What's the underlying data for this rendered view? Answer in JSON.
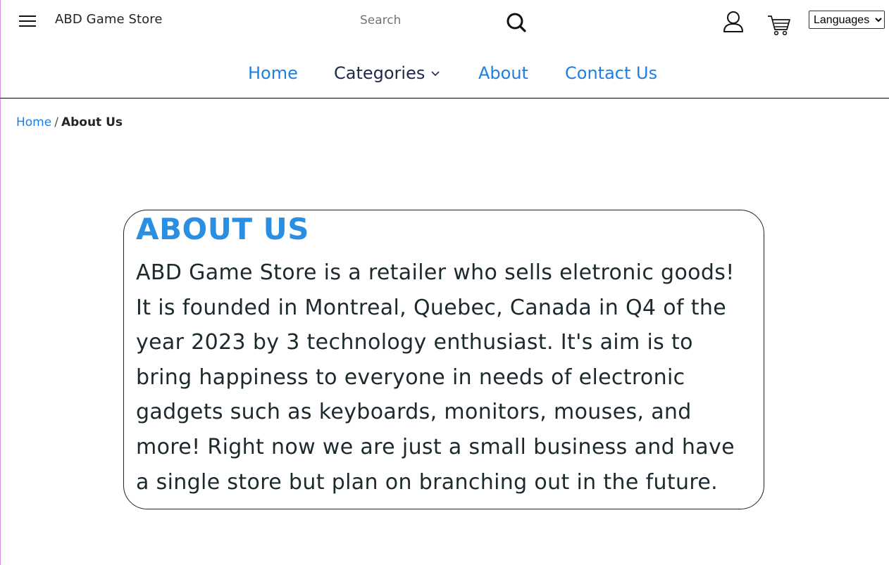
{
  "header": {
    "brand": "ABD Game Store",
    "search_placeholder": "Search",
    "languages_label": "Languages",
    "menu_icon": "hamburger-icon",
    "search_icon": "search-icon",
    "user_icon": "user-icon",
    "cart_icon": "cart-icon"
  },
  "nav": {
    "home": "Home",
    "categories": "Categories",
    "about": "About",
    "contact": "Contact Us"
  },
  "breadcrumb": {
    "home": "Home",
    "separator": "/",
    "current": "About Us"
  },
  "about": {
    "title": "ABOUT US",
    "body": "ABD Game Store is a retailer who sells eletronic goods! It is founded in Montreal, Quebec, Canada in Q4 of the year 2023 by 3 technology enthusiast. It's aim is to bring happiness to everyone in needs of electronic gadgets such as keyboards, monitors, mouses, and more! Right now we are just a small business and have a single store but plan on branching out in the future."
  },
  "colors": {
    "link": "#1f7fe0",
    "title": "#2a8fe0",
    "text": "#1c2a2e"
  }
}
